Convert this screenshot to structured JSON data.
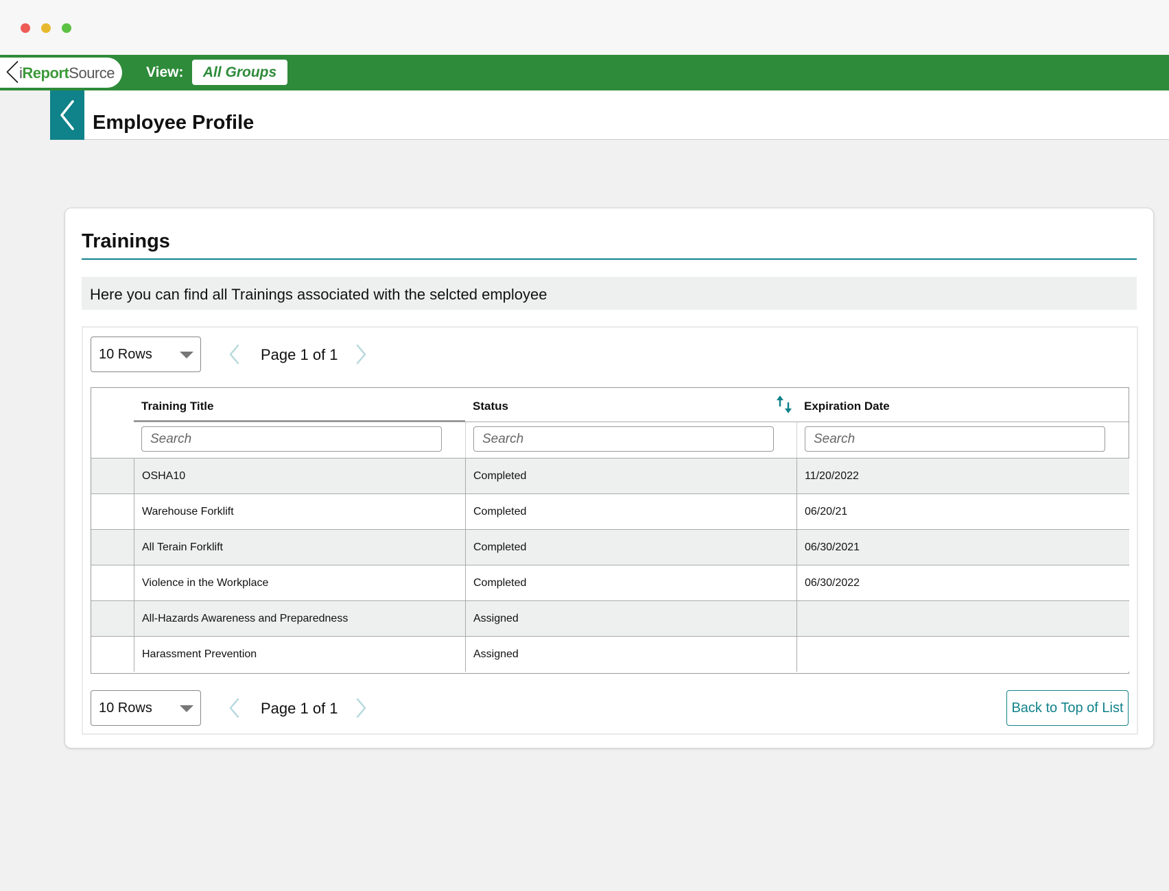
{
  "window": {
    "controls": [
      "close",
      "minimize",
      "maximize"
    ]
  },
  "appbar": {
    "logo_prefix": "i",
    "logo_accent": "Report",
    "logo_suffix": "Source",
    "view_label": "View:",
    "view_value": "All Groups"
  },
  "header": {
    "back_icon": "chevron-left-icon",
    "title": "Employee Profile"
  },
  "card": {
    "title": "Trainings",
    "info": "Here you can find all Trainings associated with the selcted employee"
  },
  "pager": {
    "rows_label": "10 Rows",
    "page_text": "Page 1 of 1"
  },
  "back_to_top": "Back to Top of List",
  "table": {
    "columns": [
      "Training Title",
      "Status",
      "Expiration Date"
    ],
    "search_placeholder": "Search",
    "rows": [
      {
        "title": "OSHA10",
        "status": "Completed",
        "expiration": "11/20/2022"
      },
      {
        "title": "Warehouse Forklift",
        "status": "Completed",
        "expiration": "06/20/21"
      },
      {
        "title": "All Terain Forklift",
        "status": "Completed",
        "expiration": "06/30/2021"
      },
      {
        "title": "Violence in the Workplace",
        "status": "Completed",
        "expiration": "06/30/2022"
      },
      {
        "title": "All-Hazards Awareness and Preparedness",
        "status": "Assigned",
        "expiration": ""
      },
      {
        "title": "Harassment Prevention",
        "status": "Assigned",
        "expiration": ""
      }
    ]
  },
  "colors": {
    "brand_green": "#2e8b3a",
    "accent_teal": "#108289"
  }
}
